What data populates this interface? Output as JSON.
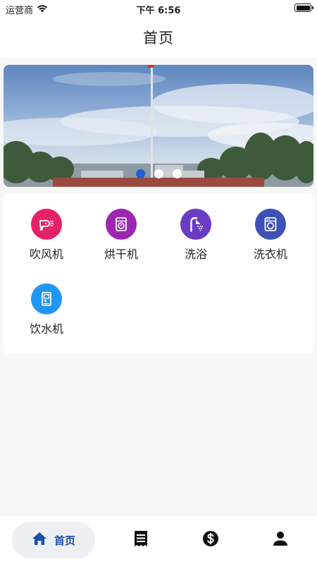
{
  "status_bar": {
    "carrier": "运营商",
    "time": "下午 6:56"
  },
  "nav": {
    "title": "首页"
  },
  "banner": {
    "slide_count": 3,
    "active_index": 0,
    "colors": {
      "active_dot": "#1e5fcf",
      "inactive_dot": "#ffffff"
    }
  },
  "services": [
    {
      "label": "吹风机",
      "icon": "hair-dryer-icon",
      "color": "#e52267"
    },
    {
      "label": "烘干机",
      "icon": "dryer-icon",
      "color": "#9c27b0"
    },
    {
      "label": "洗浴",
      "icon": "shower-icon",
      "color": "#6a3cc3"
    },
    {
      "label": "洗衣机",
      "icon": "washing-machine-icon",
      "color": "#3f51b5"
    },
    {
      "label": "饮水机",
      "icon": "water-dispenser-icon",
      "color": "#2196f3"
    }
  ],
  "tab_bar": {
    "items": [
      {
        "label": "首页",
        "icon": "home-icon",
        "active": true
      },
      {
        "icon": "receipt-icon"
      },
      {
        "icon": "dollar-icon"
      },
      {
        "icon": "person-icon"
      }
    ],
    "colors": {
      "active": "#1a4fae",
      "inactive": "#111111"
    }
  }
}
